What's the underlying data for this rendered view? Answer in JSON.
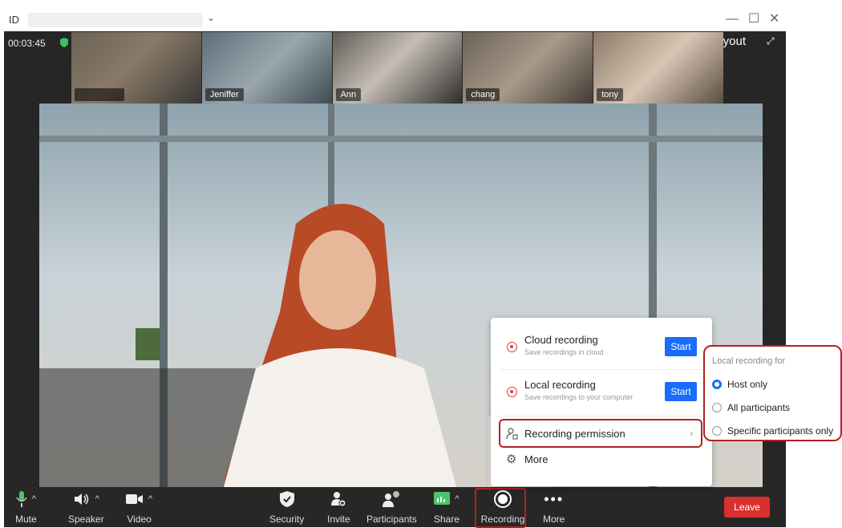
{
  "titlebar": {
    "id_label": "ID",
    "chevron": "⌄",
    "minimize": "—",
    "maximize": "☐",
    "close": "✕"
  },
  "status": {
    "timer": "00:03:45",
    "layout_label": "Layout"
  },
  "participants": [
    {
      "name": ""
    },
    {
      "name": "Jeniffer"
    },
    {
      "name": "Ann"
    },
    {
      "name": "chang"
    },
    {
      "name": "tony"
    }
  ],
  "toolbar": {
    "mute": "Mute",
    "speaker": "Speaker",
    "video": "Video",
    "security": "Security",
    "invite": "Invite",
    "participants": "Participants",
    "share": "Share",
    "recording": "Recording",
    "more": "More",
    "leave": "Leave"
  },
  "recording_menu": {
    "cloud_title": "Cloud recording",
    "cloud_sub": "Save recordings in cloud",
    "cloud_btn": "Start",
    "local_title": "Local recording",
    "local_sub": "Save recordings to your computer",
    "local_btn": "Start",
    "permission": "Recording permission",
    "more": "More"
  },
  "local_recording_panel": {
    "title": "Local recording for",
    "options": [
      "Host only",
      "All participants",
      "Specific participants only"
    ],
    "selected": "Host only"
  },
  "colors": {
    "accent": "#1a6dfa",
    "leave": "#d9302e",
    "highlight": "#b22222"
  }
}
